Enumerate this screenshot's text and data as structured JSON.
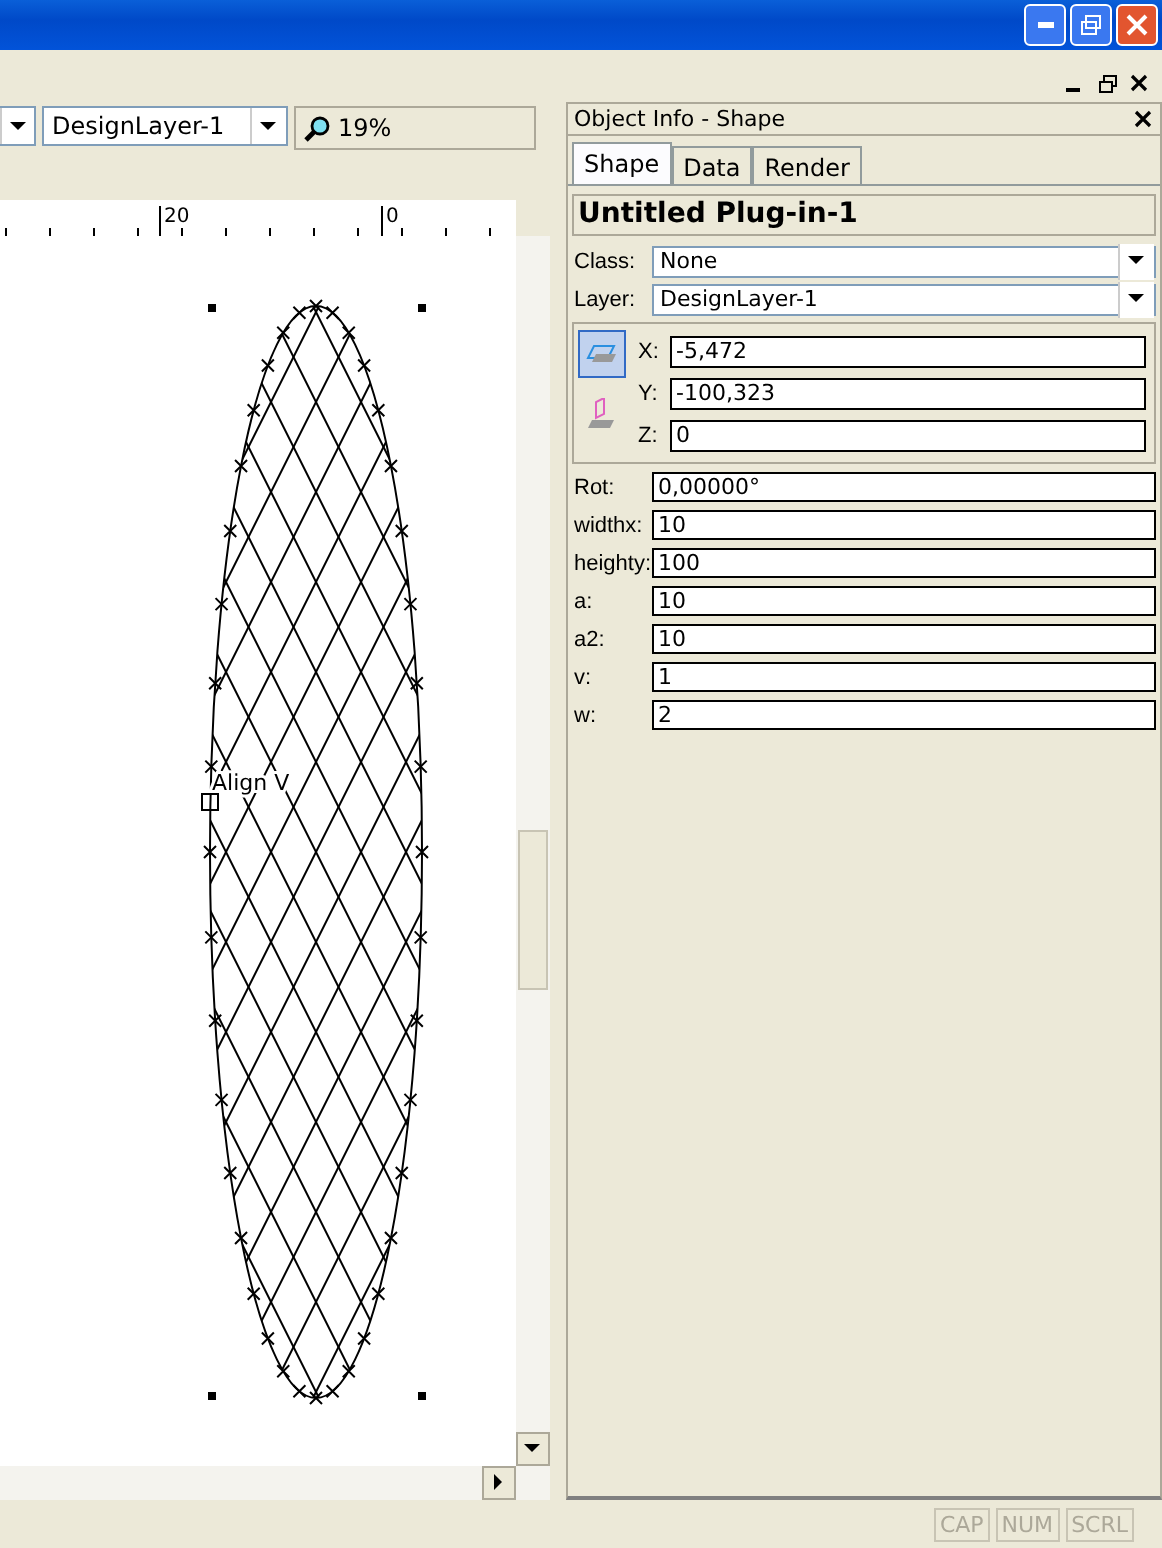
{
  "toolbar": {
    "layer_dropdown": {
      "value": "DesignLayer-1"
    },
    "zoom": {
      "value": "19%"
    }
  },
  "ruler": {
    "labels": [
      "20",
      "0"
    ]
  },
  "canvas": {
    "annotation": "Align V"
  },
  "object_info": {
    "title": "Object Info - Shape",
    "tabs": [
      {
        "label": "Shape",
        "selected": true
      },
      {
        "label": "Data",
        "selected": false
      },
      {
        "label": "Render",
        "selected": false
      }
    ],
    "object_name": "Untitled Plug-in-1",
    "dropdowns": [
      {
        "label": "Class:",
        "value": "None"
      },
      {
        "label": "Layer:",
        "value": "DesignLayer-1"
      }
    ],
    "coordinates": [
      {
        "label": "X:",
        "value": "-5,472"
      },
      {
        "label": "Y:",
        "value": "-100,323"
      },
      {
        "label": "Z:",
        "value": "0"
      }
    ],
    "parameters": [
      {
        "label": "Rot:",
        "value": "0,00000°"
      },
      {
        "label": "widthx:",
        "value": "10"
      },
      {
        "label": "heighty:",
        "value": "100"
      },
      {
        "label": "a:",
        "value": "10"
      },
      {
        "label": "a2:",
        "value": "10"
      },
      {
        "label": "v:",
        "value": "1"
      },
      {
        "label": "w:",
        "value": "2"
      }
    ]
  },
  "status_bar": {
    "indicators": [
      {
        "label": "CAP",
        "disabled": true
      },
      {
        "label": "NUM",
        "disabled": true
      },
      {
        "label": "SCRL",
        "disabled": true
      }
    ]
  }
}
